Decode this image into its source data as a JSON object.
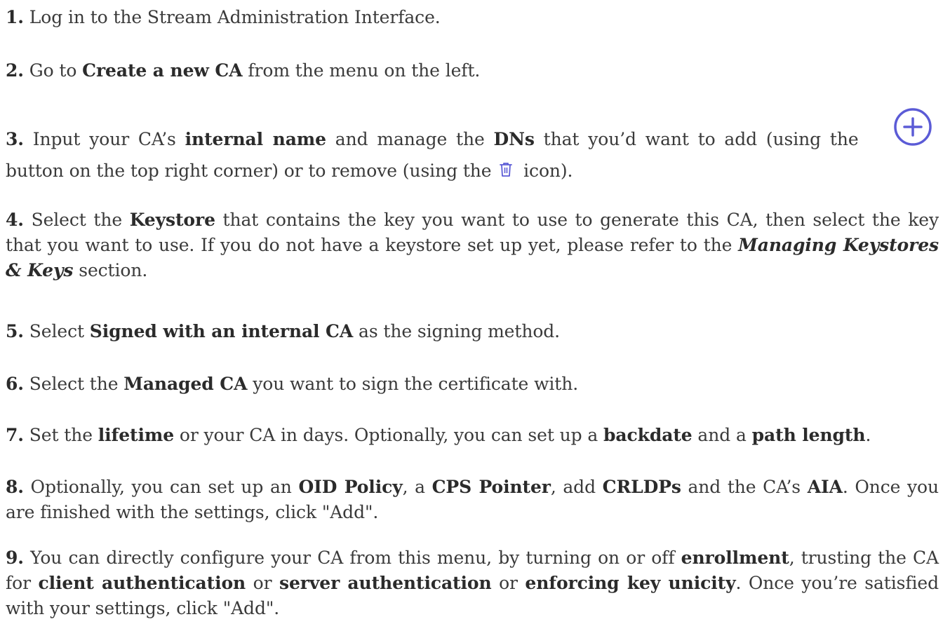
{
  "steps": [
    {
      "num": "1.",
      "t1": " Log in to the Stream Administration Interface."
    },
    {
      "num": "2.",
      "t1": " Go to ",
      "b1": "Create a new CA",
      "t2": " from the menu on the left."
    },
    {
      "num": "3.",
      "t1": " Input your CA’s ",
      "b1": "internal name",
      "t2": " and manage the ",
      "b2": "DNs",
      "t3": " that you’d want to add (using the ",
      "line2a": "button on the top right corner) or to remove (using the ",
      "line2b": " icon).",
      "add_icon": "plus-circle-icon",
      "remove_icon": "trash-icon"
    },
    {
      "num": "4.",
      "t1": " Select the ",
      "b1": "Keystore",
      "t2": " that contains the key you want to use to generate this CA, then select the key that you want to use. If you do not have a keystore set up yet, please refer to the ",
      "bi1": "Managing Keystores & Keys",
      "t3": " section."
    },
    {
      "num": "5.",
      "t1": " Select ",
      "b1": "Signed with an internal CA",
      "t2": " as the signing method."
    },
    {
      "num": "6.",
      "t1": " Select the ",
      "b1": "Managed CA",
      "t2": " you want to sign the certificate with."
    },
    {
      "num": "7.",
      "t1": " Set the ",
      "b1": "lifetime",
      "t2": " or your CA in days. Optionally, you can set up a ",
      "b2": "backdate",
      "t3": " and a ",
      "b3": "path length",
      "t4": "."
    },
    {
      "num": "8.",
      "t1": " Optionally, you can set up an ",
      "b1": "OID Policy",
      "t2": ", a ",
      "b2": "CPS Pointer",
      "t3": ", add ",
      "b3": "CRLDPs",
      "t4": " and the CA’s ",
      "b4": "AIA",
      "t5": ". Once you are finished with the settings, click \"Add\"."
    },
    {
      "num": "9.",
      "t1": " You can directly configure your CA from this menu, by turning on or off ",
      "b1": "enrollment",
      "t2": ", trusting the CA for ",
      "b2": "client authentication",
      "t3": " or ",
      "b3": "server authentication",
      "t4": " or ",
      "b4": "enforcing key unicity",
      "t5": ". Once you’re satisfied with your settings, click \"Add\"."
    }
  ],
  "colors": {
    "text": "#3a3a3a",
    "icon_accent": "#5b5bd6"
  }
}
